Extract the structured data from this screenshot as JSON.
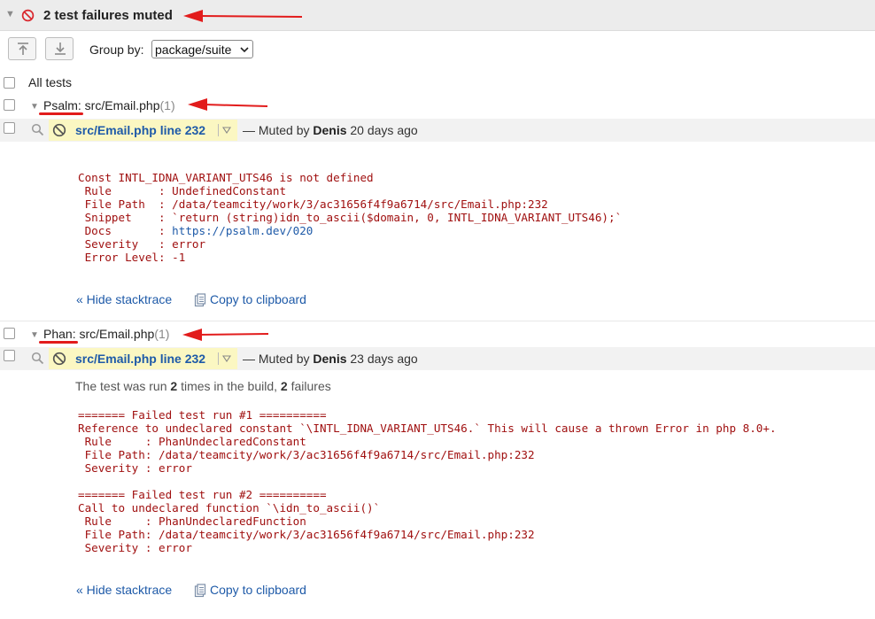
{
  "header": {
    "title": "2 test failures muted"
  },
  "toolbar": {
    "group_by_label": "Group by:",
    "group_by_value": "package/suite"
  },
  "tree": {
    "all_tests_label": "All tests",
    "groups": [
      {
        "label_prefix": "Psalm:",
        "label_rest": " src/Email.php",
        "count": "(1)",
        "test": {
          "name": "src/Email.php line 232",
          "muted_prefix": "— Muted by ",
          "muted_by": "Denis",
          "muted_when": " 20 days ago"
        },
        "trace": {
          "line1": "Const INTL_IDNA_VARIANT_UTS46 is not defined",
          "line2": " Rule       : UndefinedConstant",
          "line3": " File Path  : /data/teamcity/work/3/ac31656f4f9a6714/src/Email.php:232",
          "line4": " Snippet    : `return (string)idn_to_ascii($domain, 0, INTL_IDNA_VARIANT_UTS46);`",
          "line5_prefix": " Docs       : ",
          "line5_link": "https://psalm.dev/020",
          "line6": " Severity   : error",
          "line7": " Error Level: -1"
        },
        "actions": {
          "hide": "« Hide stacktrace",
          "copy": "Copy to clipboard"
        }
      },
      {
        "label_prefix": "Phan:",
        "label_rest": " src/Email.php",
        "count": "(1)",
        "test": {
          "name": "src/Email.php line 232",
          "muted_prefix": "— Muted by ",
          "muted_by": "Denis",
          "muted_when": " 23 days ago"
        },
        "run_info": {
          "prefix": "The test was run ",
          "runs": "2",
          "middle": " times in the build, ",
          "failures": "2",
          "suffix": " failures"
        },
        "trace": {
          "r1_header": "======= Failed test run #1 ==========",
          "r1_l1": "Reference to undeclared constant `\\INTL_IDNA_VARIANT_UTS46.` This will cause a thrown Error in php 8.0+.",
          "r1_l2": " Rule     : PhanUndeclaredConstant",
          "r1_l3": " File Path: /data/teamcity/work/3/ac31656f4f9a6714/src/Email.php:232",
          "r1_l4": " Severity : error",
          "r2_header": "======= Failed test run #2 ==========",
          "r2_l1": "Call to undeclared function `\\idn_to_ascii()`",
          "r2_l2": " Rule     : PhanUndeclaredFunction",
          "r2_l3": " File Path: /data/teamcity/work/3/ac31656f4f9a6714/src/Email.php:232",
          "r2_l4": " Severity : error"
        },
        "actions": {
          "hide": "« Hide stacktrace",
          "copy": "Copy to clipboard"
        }
      }
    ]
  },
  "icons": {
    "mute": "ban-icon",
    "collapse": "triangle-down-icon",
    "search": "search-icon",
    "dropdown": "dropdown-triangle-icon",
    "copy": "clipboard-icon",
    "expand_all": "expand-all-icon",
    "collapse_all": "collapse-all-icon"
  },
  "colors": {
    "error_text": "#a01010",
    "link": "#1e5aa8",
    "mute_icon": "#d9262c",
    "highlight": "#fbf7c2",
    "annotation": "#e21c1c"
  }
}
